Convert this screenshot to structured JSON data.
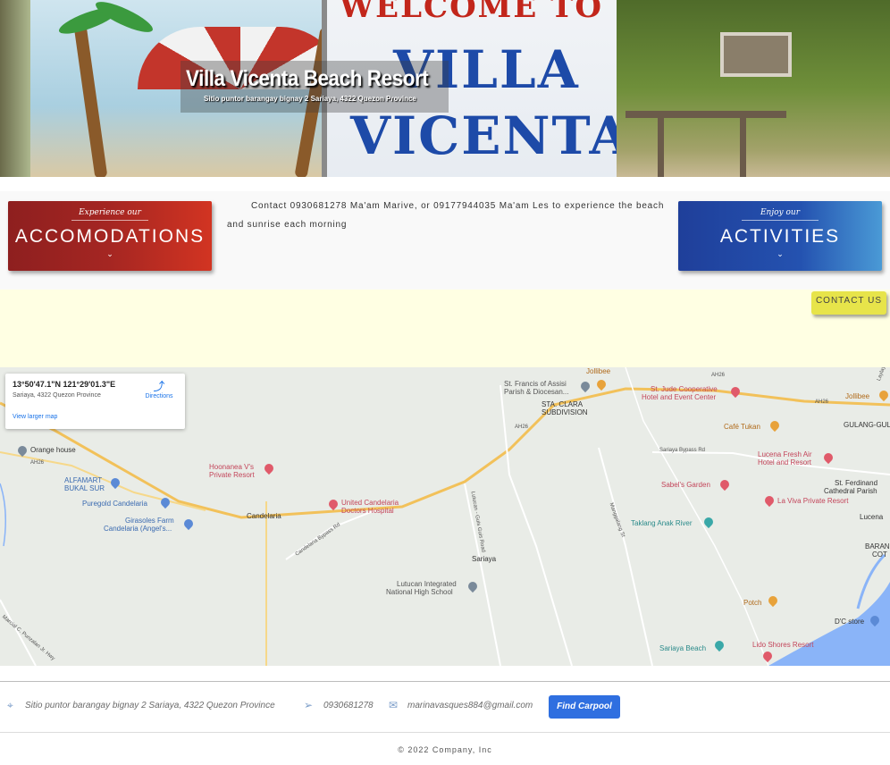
{
  "hero": {
    "title": "Villa Vicenta Beach Resort",
    "subtitle": "Sitio puntor barangay bignay 2 Sariaya, 4322 Quezon Province",
    "sign_welcome": "WELCOME TO",
    "sign_line1": "VILLA",
    "sign_line2": "VICENTA"
  },
  "cards": {
    "accommodations": {
      "small": "Experience our",
      "big": "ACCOMODATIONS",
      "chevron": "⌄"
    },
    "activities": {
      "small": "Enjoy our",
      "big": "ACTIVITIES",
      "chevron": "⌄"
    }
  },
  "contact_text": "Contact 0930681278 Ma'am Marive, or 09177944035 Ma'am Les to experience the beach and sunrise each morning",
  "contact_button": "CONTACT US",
  "map": {
    "card": {
      "coords": "13°50'47.1\"N 121°29'01.3\"E",
      "address": "Sariaya, 4322 Quezon Province",
      "link": "View larger map",
      "directions": "Directions"
    },
    "labels": {
      "jollibee1": "Jollibee",
      "stfrancis1": "St. Francis of Assisi",
      "stfrancis2": "Parish & Diocesan...",
      "stclara1": "STA. CLARA",
      "stclara2": "SUBDIVISION",
      "stjude1": "St. Jude Cooperative",
      "stjude2": "Hotel and Event Center",
      "jollibee2": "Jollibee",
      "gulang": "GULANG-GUL",
      "cafe": "Café Tukan",
      "lucena1": "Lucena Fresh Air",
      "lucena2": "Hotel and Resort",
      "stferdinand1": "St. Ferdinand",
      "stferdinand2": "Cathedral Parish",
      "lucena": "Lucena",
      "orange": "Orange house",
      "hoonanea1": "Hoonanea V's",
      "hoonanea2": "Private Resort",
      "alfamart1": "ALFAMART",
      "alfamart2": "BUKAL SUR",
      "puregold": "Puregold Candelaria",
      "girasoles1": "Girasoles Farm",
      "girasoles2": "Candelaria (Angel's...",
      "candelaria": "Candelaria",
      "ucdh1": "United Candelaria",
      "ucdh2": "Doctors Hospital",
      "sabels": "Sabel's Garden",
      "laviva": "La Viva Private Resort",
      "taklang": "Taklang Anak River",
      "sariaya": "Sariaya",
      "lutucan1": "Lutucan Integrated",
      "lutucan2": "National High School",
      "potch": "Potch",
      "dc": "D'C store",
      "sariayabeach": "Sariaya Beach",
      "lido": "Lido Shores Resort",
      "barang": "BARANG",
      "cot": "COT",
      "ah26a": "AH26",
      "ah26b": "AH26",
      "ah26c": "AH26",
      "ah26d": "AH26",
      "bypass": "Sariaya Bypass Rd",
      "candbypass": "Candelaria Bypass Rd",
      "road1": "Lutucan - Guis Guis Road",
      "road2": "Manggalang St",
      "road3": "Marcial C. Punzalan Jr. Hwy",
      "laylay": "Laylay"
    }
  },
  "footer": {
    "address": "Sitio puntor barangay bignay 2 Sariaya, 4322 Quezon Province",
    "phone": "0930681278",
    "email": "marinavasques884@gmail.com",
    "carpool": "Find Carpool",
    "copyright": "© 2022 Company, Inc"
  },
  "icons": {
    "location": "location-pin-icon",
    "phone": "send-icon",
    "email": "mail-icon"
  },
  "colors": {
    "accommodations_card": "#a52622",
    "activities_card": "#2452b0",
    "contact_button": "#e7e44a",
    "carpool_button": "#2f6fe0",
    "yellow_band": "#ffffe3"
  }
}
